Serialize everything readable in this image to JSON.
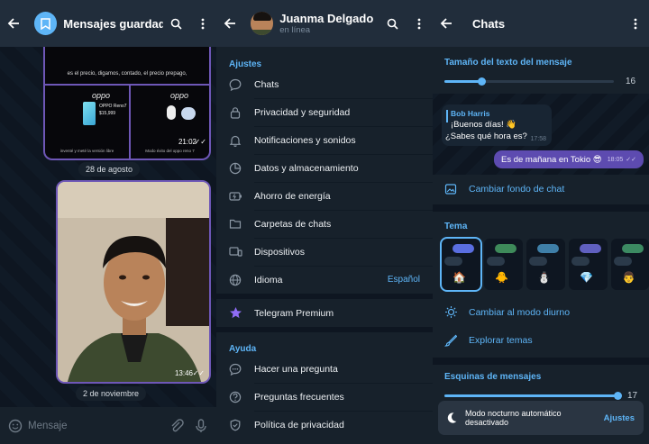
{
  "saved": {
    "title": "Mensajes guardados",
    "album_caption": "es el precio, digamos, contado, el precio prepago,",
    "album_caption2": "inventé y meté la versión libre",
    "album_caption3": "Modo éxito del oppo reno 7",
    "brand": "oppo",
    "product": "OPPO Reno7",
    "price": "$15,999",
    "album_time": "21:02",
    "date1": "28 de agosto",
    "photo_time": "13:46",
    "date2": "2 de noviembre",
    "input_placeholder": "Mensaje"
  },
  "settings": {
    "user_name": "Juanma Delgado",
    "status": "en línea",
    "section_settings": "Ajustes",
    "items": [
      {
        "label": "Chats",
        "icon": "chat-bubble-icon"
      },
      {
        "label": "Privacidad y seguridad",
        "icon": "lock-icon"
      },
      {
        "label": "Notificaciones y sonidos",
        "icon": "bell-icon"
      },
      {
        "label": "Datos y almacenamiento",
        "icon": "pie-chart-icon"
      },
      {
        "label": "Ahorro de energía",
        "icon": "battery-icon"
      },
      {
        "label": "Carpetas de chats",
        "icon": "folder-icon"
      },
      {
        "label": "Dispositivos",
        "icon": "devices-icon"
      },
      {
        "label": "Idioma",
        "icon": "globe-icon",
        "value": "Español"
      }
    ],
    "premium": "Telegram Premium",
    "section_help": "Ayuda",
    "help_items": [
      {
        "label": "Hacer una pregunta",
        "icon": "question-bubble-icon"
      },
      {
        "label": "Preguntas frecuentes",
        "icon": "help-circle-icon"
      },
      {
        "label": "Política de privacidad",
        "icon": "shield-check-icon"
      }
    ]
  },
  "chats": {
    "title": "Chats",
    "text_size_title": "Tamaño del texto del mensaje",
    "text_size_value": "16",
    "text_size_fraction": 0.22,
    "preview_sender": "Bob Harris",
    "preview_line1": "¡Buenos días! 👋",
    "preview_line2": "¿Sabes qué hora es?",
    "preview_time_in": "17:58",
    "preview_reply": "Es de mañana en Tokio 😎",
    "preview_time_out": "18:05",
    "change_bg": "Cambiar fondo de chat",
    "theme_title": "Tema",
    "themes": [
      {
        "emoji": "🏠",
        "accent": "#5a6ee0"
      },
      {
        "emoji": "🐥",
        "accent": "#3e8a5a"
      },
      {
        "emoji": "⛄",
        "accent": "#3f7fa8"
      },
      {
        "emoji": "💎",
        "accent": "#6060c0"
      },
      {
        "emoji": "👨",
        "accent": "#3c8a62"
      }
    ],
    "day_mode": "Cambiar al modo diurno",
    "explore_themes": "Explorar temas",
    "corners_title": "Esquinas de mensajes",
    "corners_value": "17",
    "corners_fraction": 1.0,
    "toast_line1": "Modo nocturno automático",
    "toast_line2": "desactivado",
    "toast_action": "Ajustes"
  },
  "colors": {
    "accent": "#5eb5f7",
    "bubble_out": "#5d4bb0",
    "premium": "#8f6cf5"
  }
}
